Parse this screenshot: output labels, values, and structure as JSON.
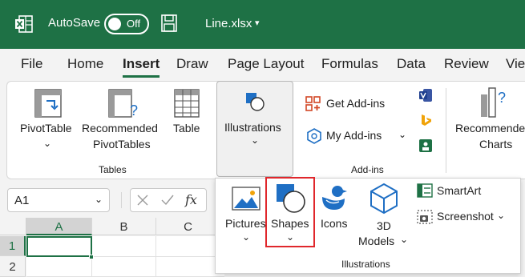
{
  "titlebar": {
    "autosave_label": "AutoSave",
    "autosave_state": "Off",
    "filename": "Line.xlsx",
    "filename_caret": "▾"
  },
  "tabs": [
    "File",
    "Home",
    "Insert",
    "Draw",
    "Page Layout",
    "Formulas",
    "Data",
    "Review",
    "Vie"
  ],
  "active_tab": "Insert",
  "ribbon": {
    "pivot_table": "PivotTable",
    "recommended_pivot_1": "Recommended",
    "recommended_pivot_2": "PivotTables",
    "table": "Table",
    "group_tables": "Tables",
    "illustrations": "Illustrations",
    "get_addins": "Get Add-ins",
    "my_addins": "My Add-ins",
    "group_addins": "Add-ins",
    "recommended_charts_1": "Recommende",
    "recommended_charts_2": "Charts"
  },
  "formula_bar": {
    "name_box": "A1",
    "fx": "fx"
  },
  "grid": {
    "columns": [
      "A",
      "B",
      "C"
    ],
    "rows": [
      "1",
      "2"
    ]
  },
  "illustrations_gallery": {
    "pictures": "Pictures",
    "shapes": "Shapes",
    "icons": "Icons",
    "models_1": "3D",
    "models_2": "Models",
    "smartart": "SmartArt",
    "screenshot": "Screenshot",
    "group_label": "Illustrations"
  },
  "colors": {
    "excel_green": "#1e7145",
    "highlight_red": "#e0272c",
    "icon_blue": "#1f6fc4"
  }
}
